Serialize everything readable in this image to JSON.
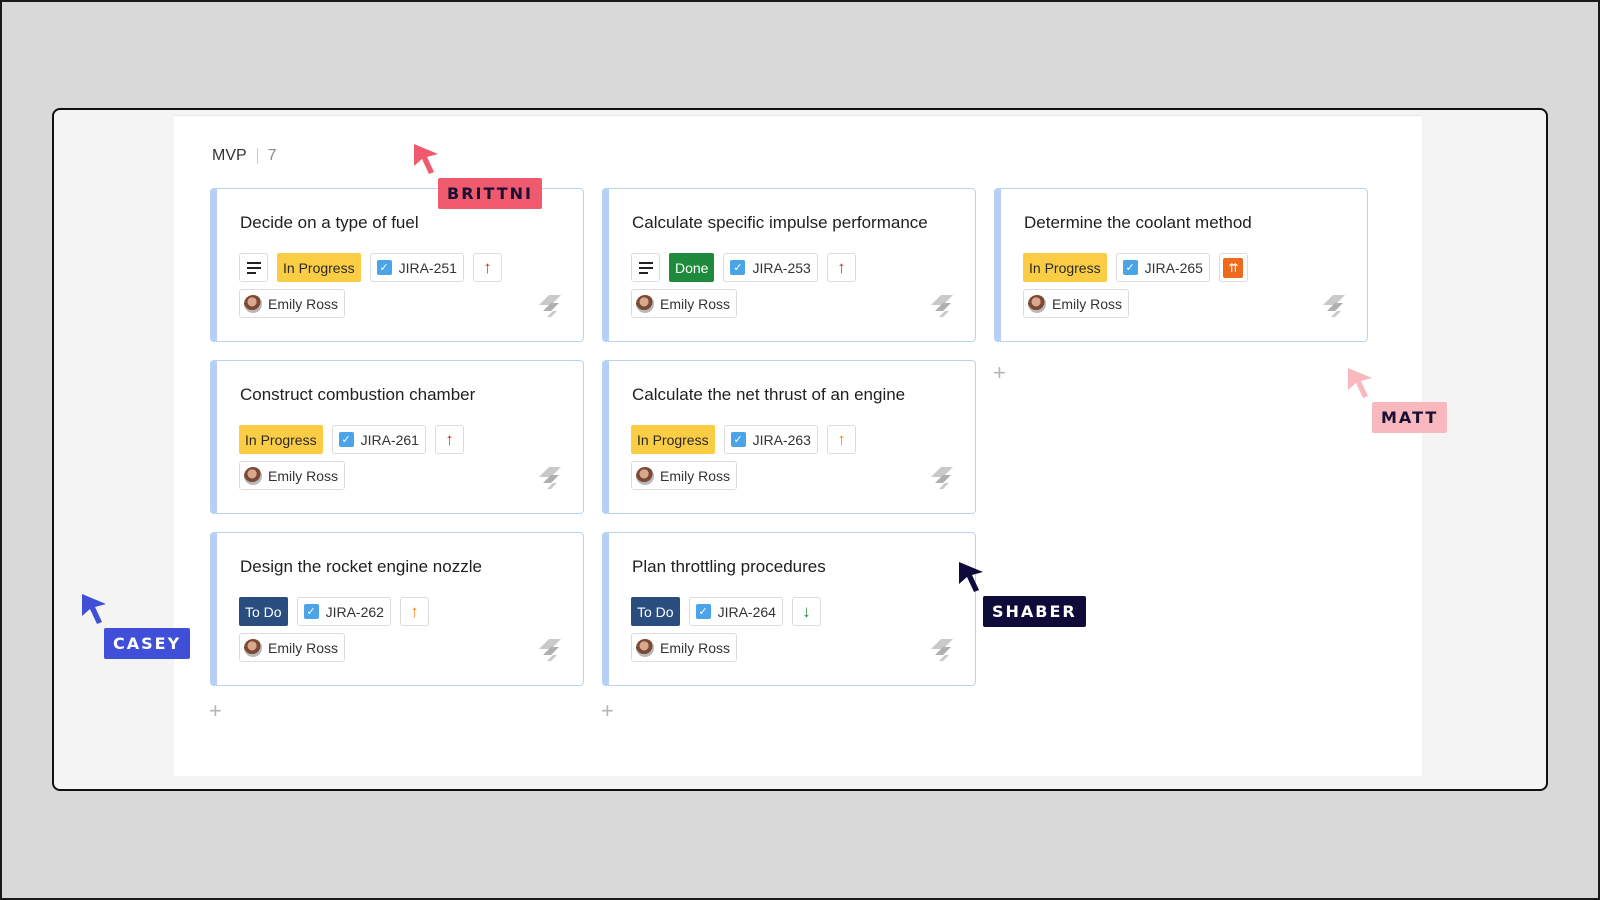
{
  "group": {
    "name": "MVP",
    "count": "7"
  },
  "cards": [
    {
      "title": "Decide on a type of fuel",
      "has_description": true,
      "status": "In Progress",
      "status_kind": "inprogress",
      "key": "JIRA-251",
      "priority": "high",
      "assignee": "Emily Ross"
    },
    {
      "title": "Calculate specific impulse performance",
      "has_description": true,
      "status": "Done",
      "status_kind": "done",
      "key": "JIRA-253",
      "priority": "high",
      "assignee": "Emily Ross"
    },
    {
      "title": "Determine the coolant method",
      "has_description": false,
      "status": "In Progress",
      "status_kind": "inprogress",
      "key": "JIRA-265",
      "priority": "highest",
      "assignee": "Emily Ross"
    },
    {
      "title": "Construct combustion chamber",
      "has_description": false,
      "status": "In Progress",
      "status_kind": "inprogress",
      "key": "JIRA-261",
      "priority": "high",
      "assignee": "Emily Ross"
    },
    {
      "title": "Calculate the net thrust of an engine",
      "has_description": false,
      "status": "In Progress",
      "status_kind": "inprogress",
      "key": "JIRA-263",
      "priority": "medium",
      "assignee": "Emily Ross"
    },
    {
      "title": "Design the rocket engine nozzle",
      "has_description": false,
      "status": "To Do",
      "status_kind": "todo",
      "key": "JIRA-262",
      "priority": "medium",
      "assignee": "Emily Ross"
    },
    {
      "title": "Plan throttling procedures",
      "has_description": false,
      "status": "To Do",
      "status_kind": "todo",
      "key": "JIRA-264",
      "priority": "low",
      "assignee": "Emily Ross"
    }
  ],
  "add_symbol": "+",
  "cursors": [
    {
      "name": "BRITTNI",
      "color": "#ef5a6f",
      "text_color": "#1a1033"
    },
    {
      "name": "MATT",
      "color": "#f9b8be",
      "text_color": "#1a1033"
    },
    {
      "name": "SHABER",
      "color": "#0e0b3a",
      "text_color": "#ffffff"
    },
    {
      "name": "CASEY",
      "color": "#3f4fd8",
      "text_color": "#ffffff"
    }
  ],
  "colors": {
    "card_border": "#b9d2f3",
    "in_progress": "#fbcd44",
    "done": "#1e8a3c",
    "todo": "#2a4d7f",
    "checkbox": "#4ba4e8"
  }
}
